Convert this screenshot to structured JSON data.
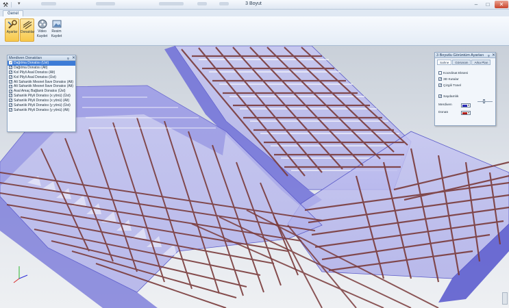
{
  "window": {
    "title": "3 Boyut"
  },
  "ribbon": {
    "tab": "Genel",
    "buttons": [
      {
        "label1": "Ayarlar",
        "label2": "",
        "active": true
      },
      {
        "label1": "Donatılar",
        "label2": "",
        "active": true
      },
      {
        "label1": "Video",
        "label2": "Kaydet",
        "active": false
      },
      {
        "label1": "Resim",
        "label2": "Kaydet",
        "active": false
      }
    ]
  },
  "rebar_panel": {
    "title": "Merdiven Donatıları",
    "items": [
      {
        "label": "Dağıtma Donatısı (Üst)",
        "checked": true,
        "selected": true
      },
      {
        "label": "Dağıtma Donatısı (Alt)",
        "checked": true,
        "selected": false
      },
      {
        "label": "Kol Pilyli Asal Donatısı (Alt)",
        "checked": true,
        "selected": false
      },
      {
        "label": "Kol Pilyli Asal Donatısı (Üst)",
        "checked": true,
        "selected": false
      },
      {
        "label": "Alt Sahanlık Mesnet İlave Donatısı (Alt)",
        "checked": true,
        "selected": false
      },
      {
        "label": "Alt Sahanlık Mesnet İlave Donatısı (Alt)",
        "checked": true,
        "selected": false
      },
      {
        "label": "Asal Amaç Bağlantı Donatısı (Üst)",
        "checked": true,
        "selected": false
      },
      {
        "label": "Sahanlık Pilyli Donatısı (x yönü) (Üst)",
        "checked": true,
        "selected": false
      },
      {
        "label": "Sahanlık Pilyli Donatısı (x yönü) (Alt)",
        "checked": true,
        "selected": false
      },
      {
        "label": "Sahanlık Pilyli Donatısı (y yönü) (Üst)",
        "checked": true,
        "selected": false
      },
      {
        "label": "Sahanlık Pilyli Donatısı (y yönü) (Alt)",
        "checked": true,
        "selected": false
      }
    ]
  },
  "settings_panel": {
    "title": "3 Boyutlu Görüntüm Ayarları",
    "tabs": [
      "Sahne",
      "Görünüm",
      "Arka Plan"
    ],
    "options": [
      {
        "label": "Koordinat Ekseni",
        "checked": false
      },
      {
        "label": "3D Kutular",
        "checked": true
      },
      {
        "label": "Çizgili Tünel",
        "checked": true
      }
    ],
    "solid_label": "Saydamlık",
    "solid_checked": true,
    "stair_label": "Merdiven",
    "rebar_label": "Donatı",
    "stair_color": "#2a2ab8",
    "rebar_color": "#b0201c"
  },
  "colors": {
    "concrete": "#7878e6",
    "rebar": "#7a3b3b"
  }
}
